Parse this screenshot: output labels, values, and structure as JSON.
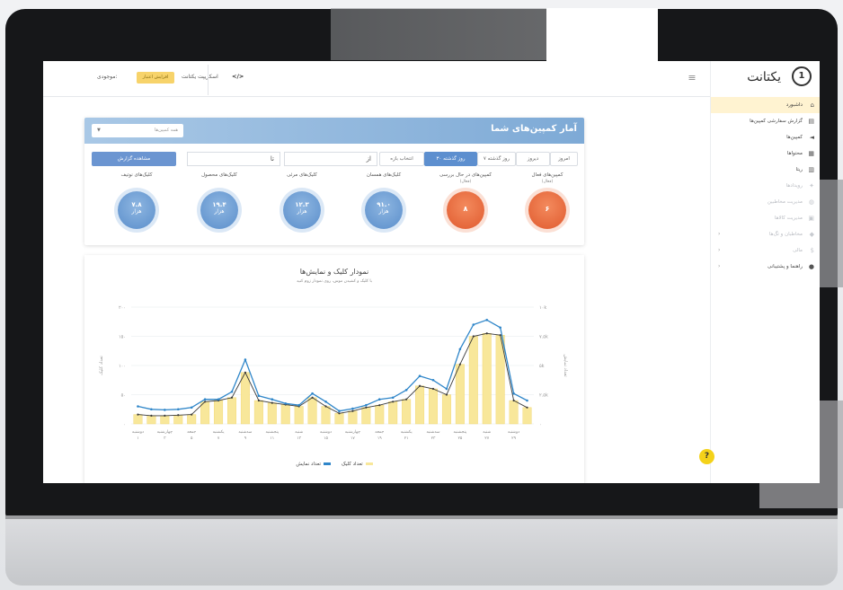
{
  "topbar": {
    "credit_label": "موجودی:",
    "charge_button": "افزایش اعتبار",
    "shop_label": "اسکریپت یکتانت",
    "api_label": "</>"
  },
  "sidebar": {
    "logo_text": "یکتانت",
    "logo_mark": "1",
    "items": [
      {
        "label": "داشبورد",
        "icon": "home-icon",
        "active": true
      },
      {
        "label": "گزارش سفارشی کمپین‌ها",
        "icon": "report-icon"
      },
      {
        "label": "کمپین‌ها",
        "icon": "megaphone-icon"
      },
      {
        "label": "محتواها",
        "icon": "file-icon"
      },
      {
        "label": "ریتا",
        "icon": "chart-icon"
      },
      {
        "label": "رویدادها",
        "icon": "event-icon",
        "dim": true
      },
      {
        "label": "مدیریت مخاطبین",
        "icon": "users-icon",
        "dim": true
      },
      {
        "label": "مدیریت کالاها",
        "icon": "box-icon",
        "dim": true
      },
      {
        "label": "مخاطبان و تگ‌ها",
        "icon": "tag-icon",
        "arrow": true,
        "dim": true
      },
      {
        "label": "مالی",
        "icon": "wallet-icon",
        "arrow": true,
        "dim": true
      },
      {
        "label": "راهنما و پشتیبانی",
        "icon": "help-icon",
        "arrow": true
      }
    ]
  },
  "stats": {
    "title": "آمار کمپین‌های شما",
    "select_placeholder": "همه کمپین‌ها",
    "filters": [
      "امروز",
      "دیروز",
      "۷ روز گذشته",
      "۳۰ روز گذشته",
      "انتخاب بازه"
    ],
    "active_filter": "۳۰ روز گذشته",
    "date_from": "از",
    "date_to": "تا",
    "show_button": "مشاهده گزارش",
    "items": [
      {
        "label": "کمپین‌های فعال",
        "sub": "(فعال)",
        "value": "۶",
        "unit": "",
        "color": "#e05a2e"
      },
      {
        "label": "کمپین‌های در حال بررسی",
        "sub": "(فعال)",
        "value": "۸",
        "unit": "",
        "color": "#e05a2e"
      },
      {
        "label": "کلیک‌های همسان",
        "sub": "",
        "value": "۹۱.۰",
        "unit": "هزار",
        "color": "#5a8ecb"
      },
      {
        "label": "کلیک‌های مرئی",
        "sub": "",
        "value": "۱۲.۳",
        "unit": "هزار",
        "color": "#5a8ecb"
      },
      {
        "label": "کلیک‌های محصول",
        "sub": "",
        "value": "۱۹.۴",
        "unit": "هزار",
        "color": "#5a8ecb"
      },
      {
        "label": "کلیک‌های نوتیف",
        "sub": "",
        "value": "۷.۸",
        "unit": "هزار",
        "color": "#5a8ecb"
      }
    ]
  },
  "chart_section": {
    "title": "نمودار کلیک و نمایش‌ها",
    "subtitle": "با کلیک و کشیدن موس، روی نمودار زوم کنید",
    "legend": {
      "clicks": "تعداد کلیک",
      "impressions": "تعداد نمایش"
    }
  },
  "help_button": "?",
  "colors": {
    "accent": "#5d8fcf",
    "red": "#e05a2e",
    "bar": "#f8e79a",
    "line_blue": "#2f86c9",
    "line_dark": "#3a3a3a"
  },
  "chart_data": {
    "type": "bar",
    "categories": [
      "دوشنبه",
      "سه‌شنبه",
      "چهارشنبه",
      "پنجشنبه",
      "جمعه",
      "شنبه",
      "یکشنبه",
      "دوشنبه",
      "سه‌شنبه",
      "چهارشنبه",
      "پنجشنبه",
      "جمعه",
      "شنبه",
      "یکشنبه",
      "دوشنبه",
      "سه‌شنبه",
      "چهارشنبه",
      "پنجشنبه",
      "جمعه",
      "شنبه",
      "یکشنبه",
      "دوشنبه",
      "سه‌شنبه",
      "چهارشنبه",
      "پنجشنبه",
      "جمعه",
      "شنبه",
      "یکشنبه",
      "دوشنبه",
      "سه‌شنبه"
    ],
    "x_tick_numbers": [
      "۱",
      "۳",
      "۵",
      "۷",
      "۹",
      "۱۱",
      "۱۳",
      "۱۵",
      "۱۷",
      "۱۹",
      "۲۱",
      "۲۳",
      "۲۵",
      "۲۷",
      "۲۹"
    ],
    "y_left_ticks": [
      "۰",
      "۵۰",
      "۱۰۰",
      "۱۵۰",
      "۲۰۰"
    ],
    "y_right_ticks": [
      "۰",
      "۲.۵k",
      "۵k",
      "۷.۵k",
      "۱۰k"
    ],
    "y_left_label": "تعداد کلیک",
    "y_right_label": "تعداد نمایش",
    "ylim_left": [
      0,
      200
    ],
    "series": [
      {
        "name": "تعداد کلیک",
        "kind": "bar+line",
        "values": [
          16,
          14,
          14,
          15,
          16,
          38,
          40,
          45,
          88,
          40,
          36,
          33,
          30,
          45,
          30,
          18,
          22,
          28,
          32,
          38,
          42,
          65,
          60,
          50,
          102,
          150,
          155,
          152,
          40,
          28
        ]
      },
      {
        "name": "تعداد نمایش",
        "kind": "line",
        "values": [
          30,
          25,
          24,
          25,
          28,
          42,
          42,
          55,
          110,
          48,
          42,
          35,
          32,
          52,
          38,
          22,
          26,
          32,
          42,
          45,
          58,
          82,
          75,
          60,
          128,
          170,
          178,
          165,
          52,
          40
        ]
      }
    ]
  }
}
